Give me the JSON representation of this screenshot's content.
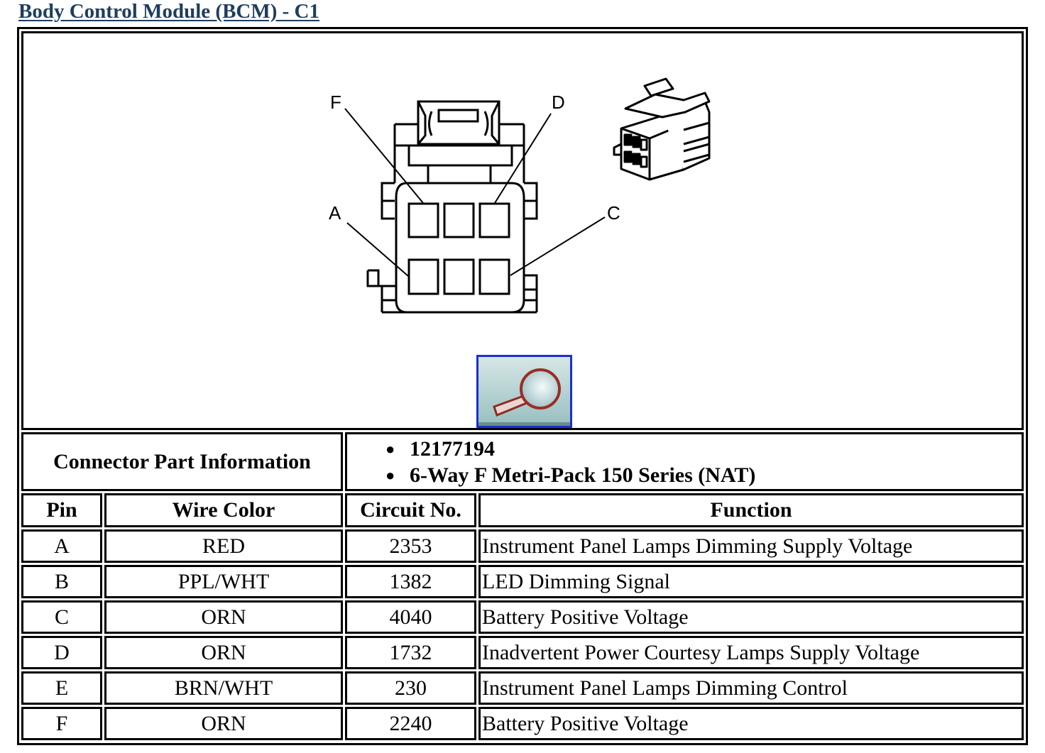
{
  "page": {
    "title": "Body Control Module (BCM) - C1"
  },
  "diagram": {
    "pin_labels": {
      "F": "F",
      "D": "D",
      "A": "A",
      "C": "C"
    },
    "zoom_button_icon": "magnifier-icon"
  },
  "connector_info": {
    "label": "Connector Part Information",
    "items": [
      "12177194",
      "6-Way F Metri-Pack 150 Series (NAT)"
    ]
  },
  "table": {
    "headers": {
      "pin": "Pin",
      "wire_color": "Wire Color",
      "circuit": "Circuit No.",
      "function": "Function"
    },
    "rows": [
      {
        "pin": "A",
        "wire_color": "RED",
        "circuit": "2353",
        "function": "Instrument Panel Lamps Dimming Supply Voltage"
      },
      {
        "pin": "B",
        "wire_color": "PPL/WHT",
        "circuit": "1382",
        "function": "LED Dimming Signal"
      },
      {
        "pin": "C",
        "wire_color": "ORN",
        "circuit": "4040",
        "function": "Battery Positive Voltage"
      },
      {
        "pin": "D",
        "wire_color": "ORN",
        "circuit": "1732",
        "function": "Inadvertent Power Courtesy Lamps Supply Voltage"
      },
      {
        "pin": "E",
        "wire_color": "BRN/WHT",
        "circuit": "230",
        "function": "Instrument Panel Lamps Dimming Control"
      },
      {
        "pin": "F",
        "wire_color": "ORN",
        "circuit": "2240",
        "function": "Battery Positive Voltage"
      }
    ]
  },
  "colors": {
    "title": "#1f3d5e",
    "zoom_button_border": "#1a2fd0"
  }
}
